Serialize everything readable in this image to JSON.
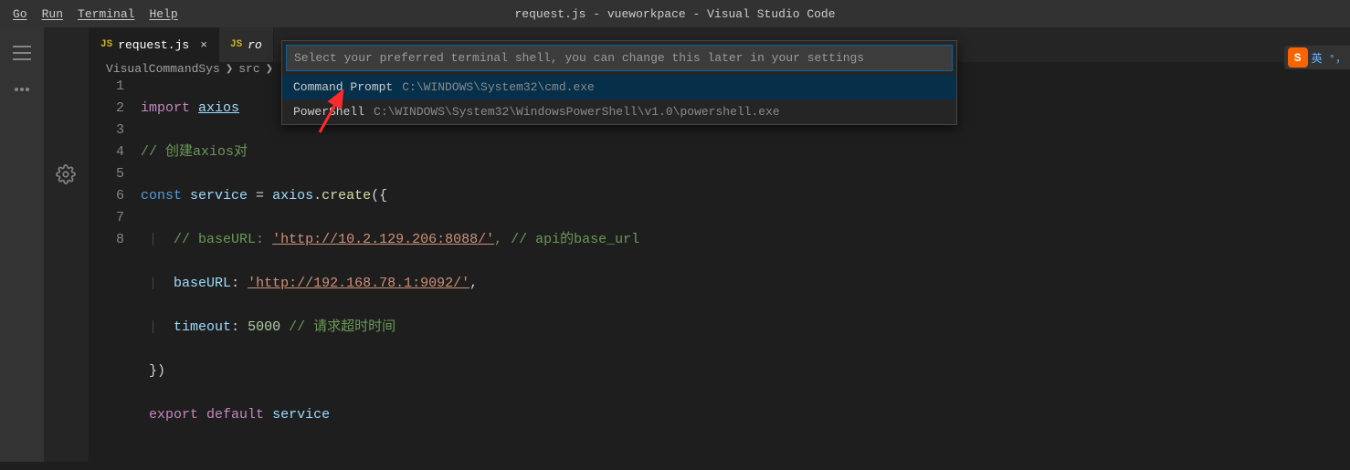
{
  "menubar": {
    "items": [
      "Go",
      "Run",
      "Terminal",
      "Help"
    ]
  },
  "window_title": "request.js - vueworkpace - Visual Studio Code",
  "tabs": [
    {
      "badge": "JS",
      "name": "request.js",
      "active": true
    },
    {
      "badge": "JS",
      "name": "ro",
      "active": false
    }
  ],
  "breadcrumb": {
    "parts": [
      "VisualCommandSys",
      "src"
    ]
  },
  "code": {
    "lines": [
      1,
      2,
      3,
      4,
      5,
      6,
      7,
      8
    ],
    "l1_kw": "import",
    "l1_id": "axios",
    "l2_cmt": "// 创建axios对",
    "l3_kw": "const",
    "l3_id": "service",
    "l3_eq": " = ",
    "l3_ax": "axios",
    "l3_dot": ".",
    "l3_fn": "create",
    "l3_paren": "({",
    "l4_cmt1": "// baseURL: ",
    "l4_url": "'http://10.2.129.206:8088/'",
    "l4_cmt2": ", // api的base_url",
    "l5_key": "baseURL",
    "l5_colon": ": ",
    "l5_url": "'http://192.168.78.1:9092/'",
    "l5_comma": ",",
    "l6_key": "timeout",
    "l6_colon": ": ",
    "l6_val": "5000",
    "l6_cmt": " // 请求超时时间",
    "l7": "})",
    "l8_kw": "export",
    "l8_kw2": "default",
    "l8_id": "service"
  },
  "picker": {
    "placeholder": "Select your preferred terminal shell, you can change this later in your settings",
    "items": [
      {
        "label": "Command Prompt",
        "desc": "C:\\WINDOWS\\System32\\cmd.exe",
        "selected": true
      },
      {
        "label": "PowerShell",
        "desc": "C:\\WINDOWS\\System32\\WindowsPowerShell\\v1.0\\powershell.exe",
        "selected": false
      }
    ]
  },
  "ime": {
    "icon": "S",
    "text": "英 °，"
  }
}
